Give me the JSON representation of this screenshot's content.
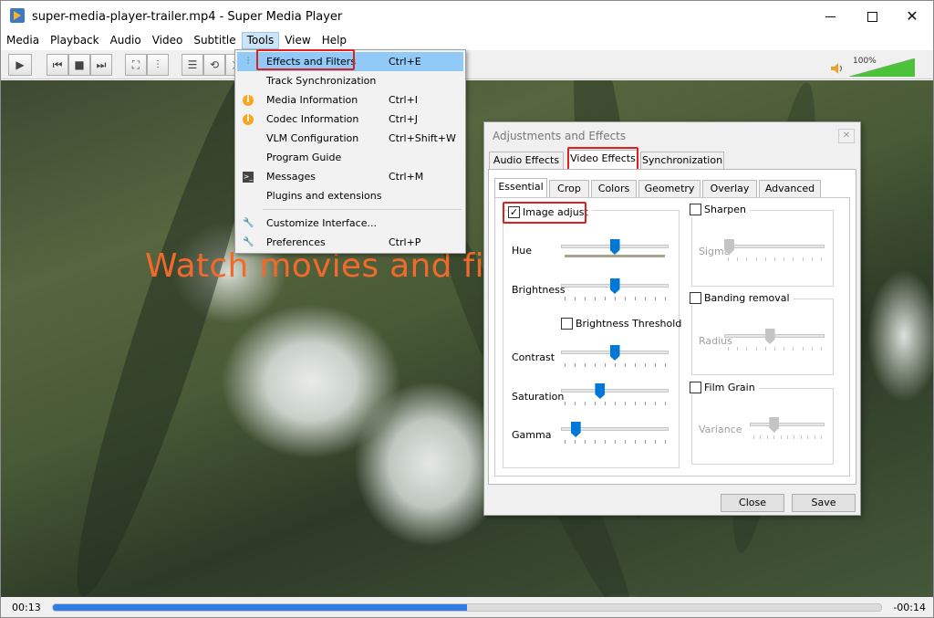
{
  "window": {
    "title": "super-media-player-trailer.mp4 - Super Media Player"
  },
  "menu": [
    "Media",
    "Playback",
    "Audio",
    "Video",
    "Subtitle",
    "Tools",
    "View",
    "Help"
  ],
  "volume": {
    "percent_label": "100%",
    "level": 1.0
  },
  "video": {
    "overlay_text": "Watch movies and fil"
  },
  "tools_menu": {
    "items": [
      {
        "label": "Effects and Filters",
        "shortcut": "Ctrl+E",
        "icon": "equalizer-icon"
      },
      {
        "label": "Track Synchronization",
        "shortcut": "",
        "icon": ""
      },
      {
        "label": "Media Information",
        "shortcut": "Ctrl+I",
        "icon": "info-icon"
      },
      {
        "label": "Codec Information",
        "shortcut": "Ctrl+J",
        "icon": "info-icon"
      },
      {
        "label": "VLM Configuration",
        "shortcut": "Ctrl+Shift+W",
        "icon": ""
      },
      {
        "label": "Program Guide",
        "shortcut": "",
        "icon": ""
      },
      {
        "label": "Messages",
        "shortcut": "Ctrl+M",
        "icon": "terminal-icon"
      },
      {
        "label": "Plugins and extensions",
        "shortcut": "",
        "icon": ""
      },
      {
        "label": "Customize Interface...",
        "shortcut": "",
        "icon": "wrench-icon"
      },
      {
        "label": "Preferences",
        "shortcut": "Ctrl+P",
        "icon": "wrench-icon"
      }
    ]
  },
  "dialog": {
    "title": "Adjustments and Effects",
    "tabs": [
      "Audio Effects",
      "Video Effects",
      "Synchronization"
    ],
    "subtabs": [
      "Essential",
      "Crop",
      "Colors",
      "Geometry",
      "Overlay",
      "Advanced"
    ],
    "image_adjust": {
      "label": "Image adjust",
      "checked": true,
      "hue_label": "Hue",
      "brightness_label": "Brightness",
      "brightness_threshold_label": "Brightness Threshold",
      "contrast_label": "Contrast",
      "saturation_label": "Saturation",
      "gamma_label": "Gamma",
      "levels": {
        "hue": 0.5,
        "brightness": 0.5,
        "contrast": 0.5,
        "saturation": 0.35,
        "gamma": 0.1
      }
    },
    "sharpen": {
      "label": "Sharpen",
      "param": "Sigma",
      "level": 0.0
    },
    "banding": {
      "label": "Banding removal",
      "param": "Radius",
      "level": 0.45
    },
    "film_grain": {
      "label": "Film Grain",
      "param": "Variance",
      "level": 0.3
    },
    "close_label": "Close",
    "save_label": "Save"
  },
  "playback": {
    "elapsed": "00:13",
    "remaining": "-00:14",
    "progress": 0.5
  }
}
